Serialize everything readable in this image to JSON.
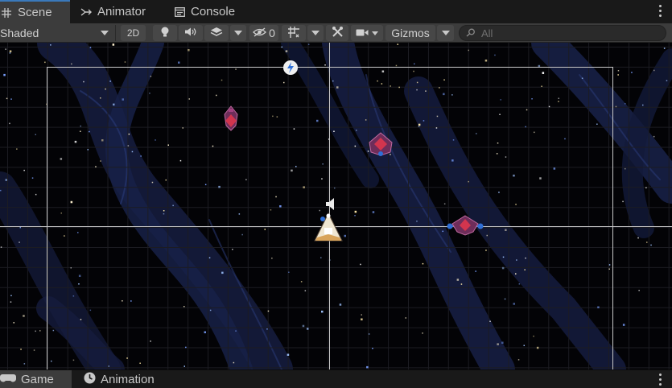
{
  "top_tabs": [
    {
      "label": "Scene",
      "icon": "grid-icon",
      "active": true
    },
    {
      "label": "Animator",
      "icon": "animator-icon",
      "active": false
    },
    {
      "label": "Console",
      "icon": "console-icon",
      "active": false
    }
  ],
  "toolbar": {
    "shading_mode": "Shaded",
    "mode_2d": "2D",
    "hidden_count": "0",
    "gizmos_label": "Gizmos",
    "search_placeholder": "All"
  },
  "bottom_tabs": [
    {
      "label": "Game",
      "icon": "gamepad-icon",
      "active": true
    },
    {
      "label": "Animation",
      "icon": "clock-icon",
      "active": false
    }
  ],
  "scene": {
    "objects": [
      "player-ship",
      "enemy-ship-1",
      "enemy-ship-2",
      "enemy-ship-3"
    ]
  },
  "colors": {
    "tab_active_accent": "#3a79bb",
    "toolbar_bg": "#3c3c3c",
    "scene_bg": "#030306",
    "nebula": "#1a2246",
    "enemy": "#a4324c",
    "gizmo_blue": "#2f6fd6"
  }
}
